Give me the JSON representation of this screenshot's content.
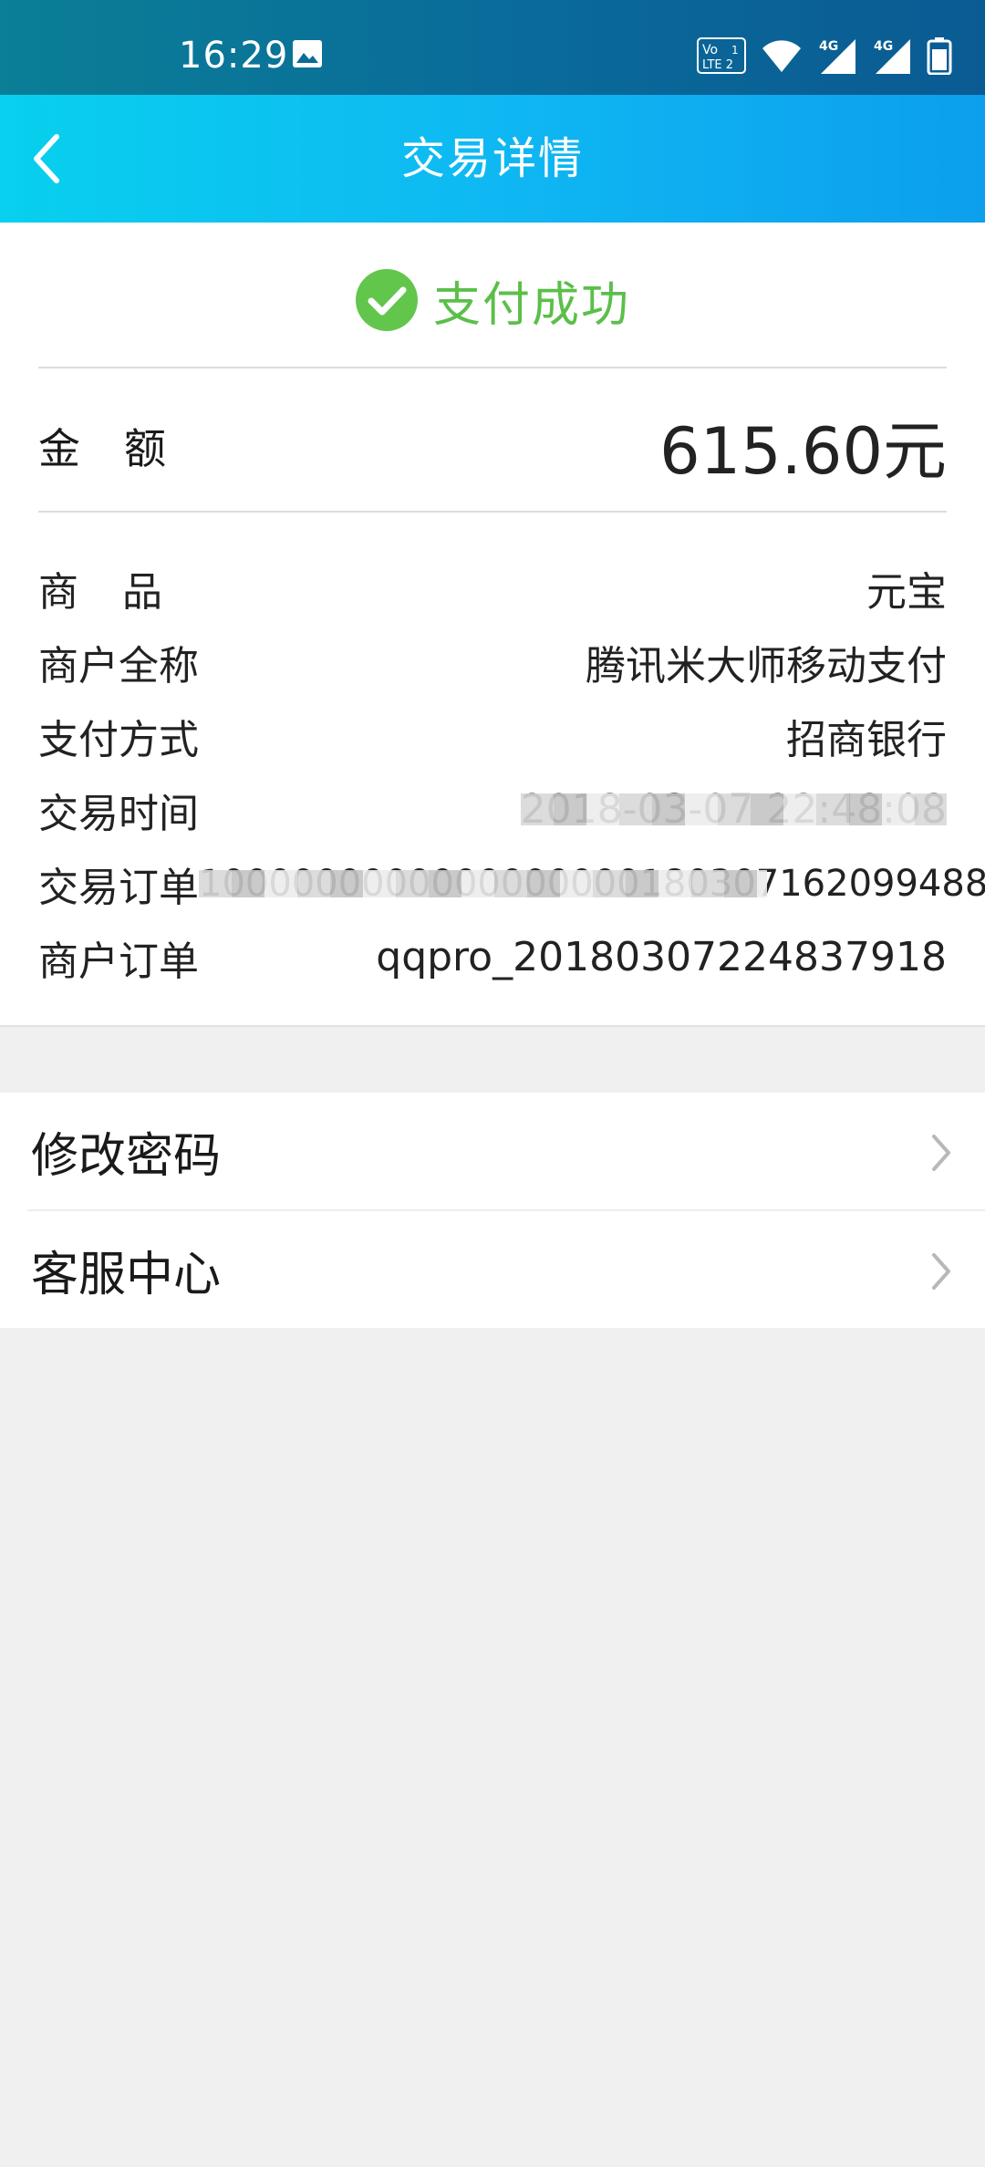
{
  "status_bar": {
    "time": "16:29",
    "icons": [
      "gallery-icon",
      "volte-icon",
      "wifi-icon",
      "signal-4g-icon",
      "signal-4g-icon",
      "battery-icon"
    ]
  },
  "header": {
    "title": "交易详情"
  },
  "status": {
    "text": "支付成功",
    "color": "#5bbf49"
  },
  "amount": {
    "label": "金额",
    "value": "615.60元"
  },
  "details": [
    {
      "label": "商品",
      "value": "元宝"
    },
    {
      "label": "商户全称",
      "value": "腾讯米大师移动支付"
    },
    {
      "label": "支付方式",
      "value": "招商银行"
    },
    {
      "label": "交易时间",
      "value": "2018-03-07 22:48:08"
    },
    {
      "label": "交易订单",
      "value": "1000000000000000000180307162099488"
    },
    {
      "label": "商户订单",
      "value": "qqpro_20180307224837918"
    }
  ],
  "menu": [
    {
      "label": "修改密码"
    },
    {
      "label": "客服中心"
    }
  ],
  "colors": {
    "header_gradient_start": "#08d0ee",
    "header_gradient_end": "#0c9fed",
    "success_green": "#5bbf49"
  }
}
